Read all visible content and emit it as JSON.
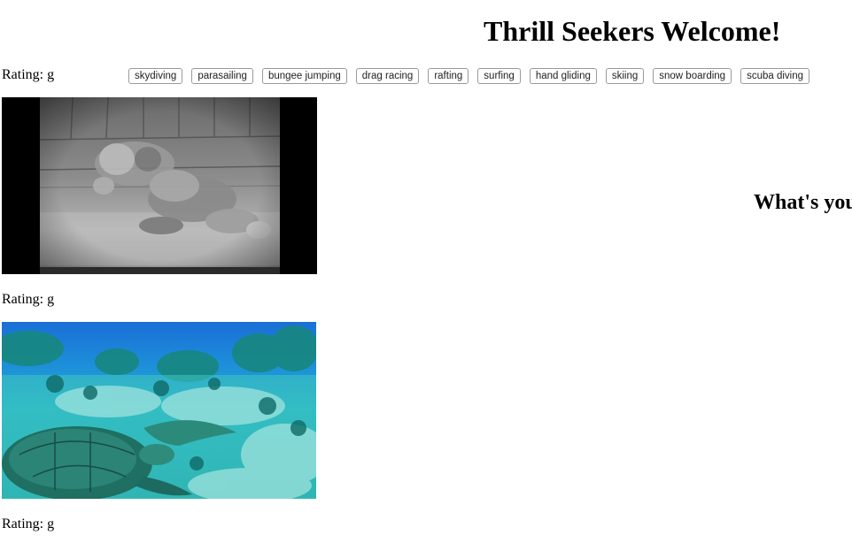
{
  "header": {
    "title": "Thrill Seekers Welcome!"
  },
  "topics": [
    {
      "label": "skydiving"
    },
    {
      "label": "parasailing"
    },
    {
      "label": "bungee jumping"
    },
    {
      "label": "drag racing"
    },
    {
      "label": "rafting"
    },
    {
      "label": "surfing"
    },
    {
      "label": "hand gliding"
    },
    {
      "label": "skiing"
    },
    {
      "label": "snow boarding"
    },
    {
      "label": "scuba diving"
    }
  ],
  "gifs": [
    {
      "rating": "Rating: g",
      "image": "black-and-white-diver-gif"
    },
    {
      "rating": "Rating: g",
      "image": "sea-turtle-reef-gif"
    },
    {
      "rating": "Rating: g"
    }
  ],
  "question": {
    "text": "What's you"
  }
}
